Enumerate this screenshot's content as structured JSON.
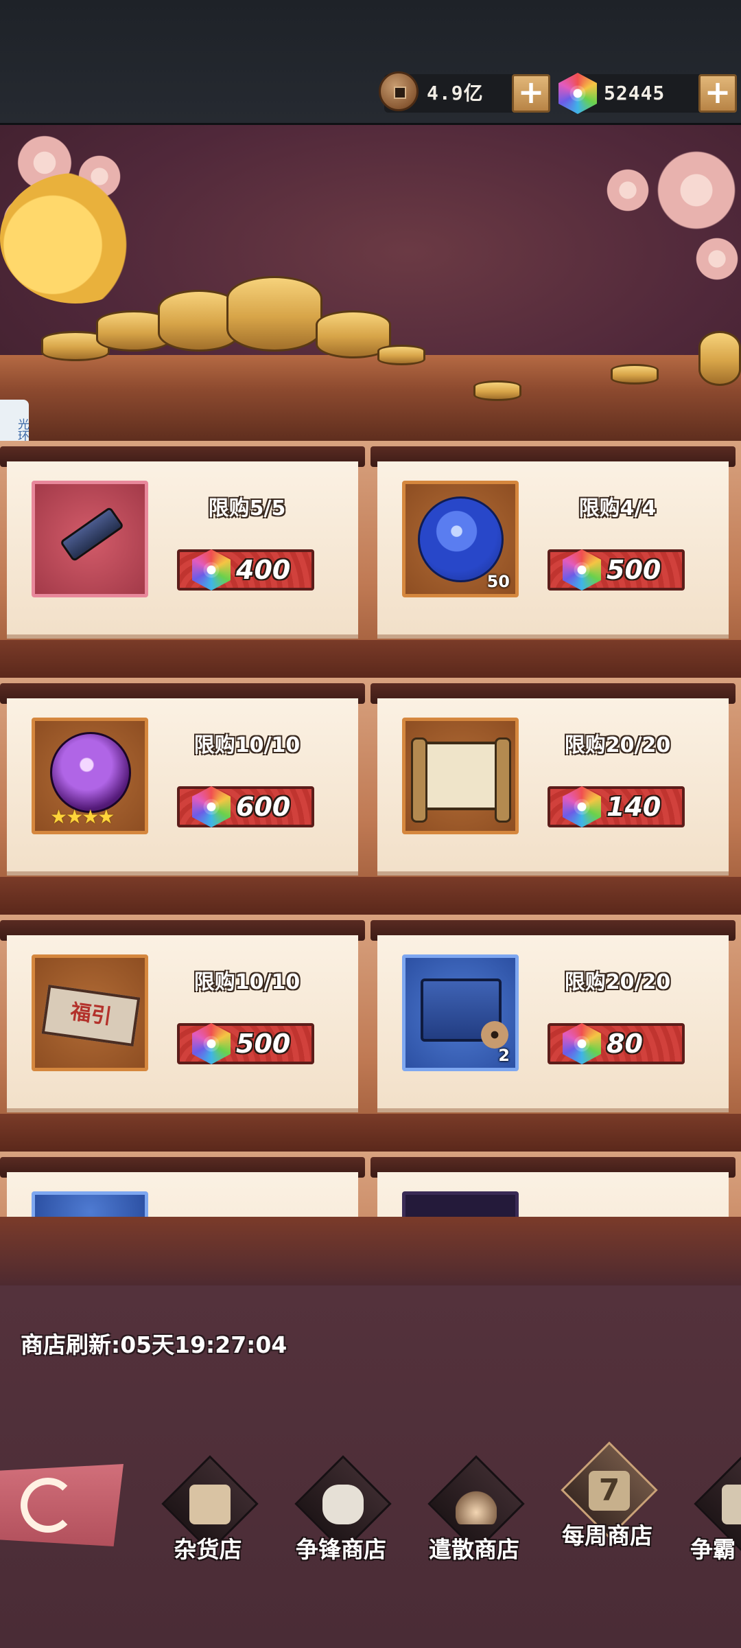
{
  "header": {
    "coins": {
      "value": "4.9亿",
      "icon": "copper-coin-icon"
    },
    "gems": {
      "value": "52445",
      "icon": "rainbow-gem-icon"
    },
    "add_label": "+"
  },
  "side_tab": {
    "label": "光环助手"
  },
  "shop": {
    "items": [
      {
        "limit": "限购5/5",
        "price": "400",
        "icon": "scroll-icon",
        "qty": ""
      },
      {
        "limit": "限购4/4",
        "price": "500",
        "icon": "blue-orb-icon",
        "qty": "50"
      },
      {
        "limit": "限购10/10",
        "price": "600",
        "icon": "purple-soul-orb-icon",
        "qty": "",
        "stars": "★★★★"
      },
      {
        "limit": "限购20/20",
        "price": "140",
        "icon": "map-scroll-icon",
        "qty": ""
      },
      {
        "limit": "限购10/10",
        "price": "500",
        "icon": "fortune-banner-icon",
        "qty": "",
        "art_text": "福引"
      },
      {
        "limit": "限购20/20",
        "price": "80",
        "icon": "blue-treasure-box-icon",
        "qty": "2"
      }
    ]
  },
  "refresh": {
    "text": "商店刷新:05天19:27:04"
  },
  "nav": {
    "tabs": [
      {
        "label": "杂货店",
        "icon": "box-icon"
      },
      {
        "label": "争锋商店",
        "icon": "rock-icon"
      },
      {
        "label": "遣散商店",
        "icon": "flame-icon"
      },
      {
        "label": "每周商店",
        "icon": "calendar-seven-icon",
        "active": true
      },
      {
        "label": "争霸",
        "icon": "beast-icon"
      }
    ]
  },
  "colors": {
    "price_red": "#c0342f",
    "frame_orange": "#d5873e",
    "frame_blue": "#7ea7f0",
    "frame_pink": "#e8889b"
  }
}
